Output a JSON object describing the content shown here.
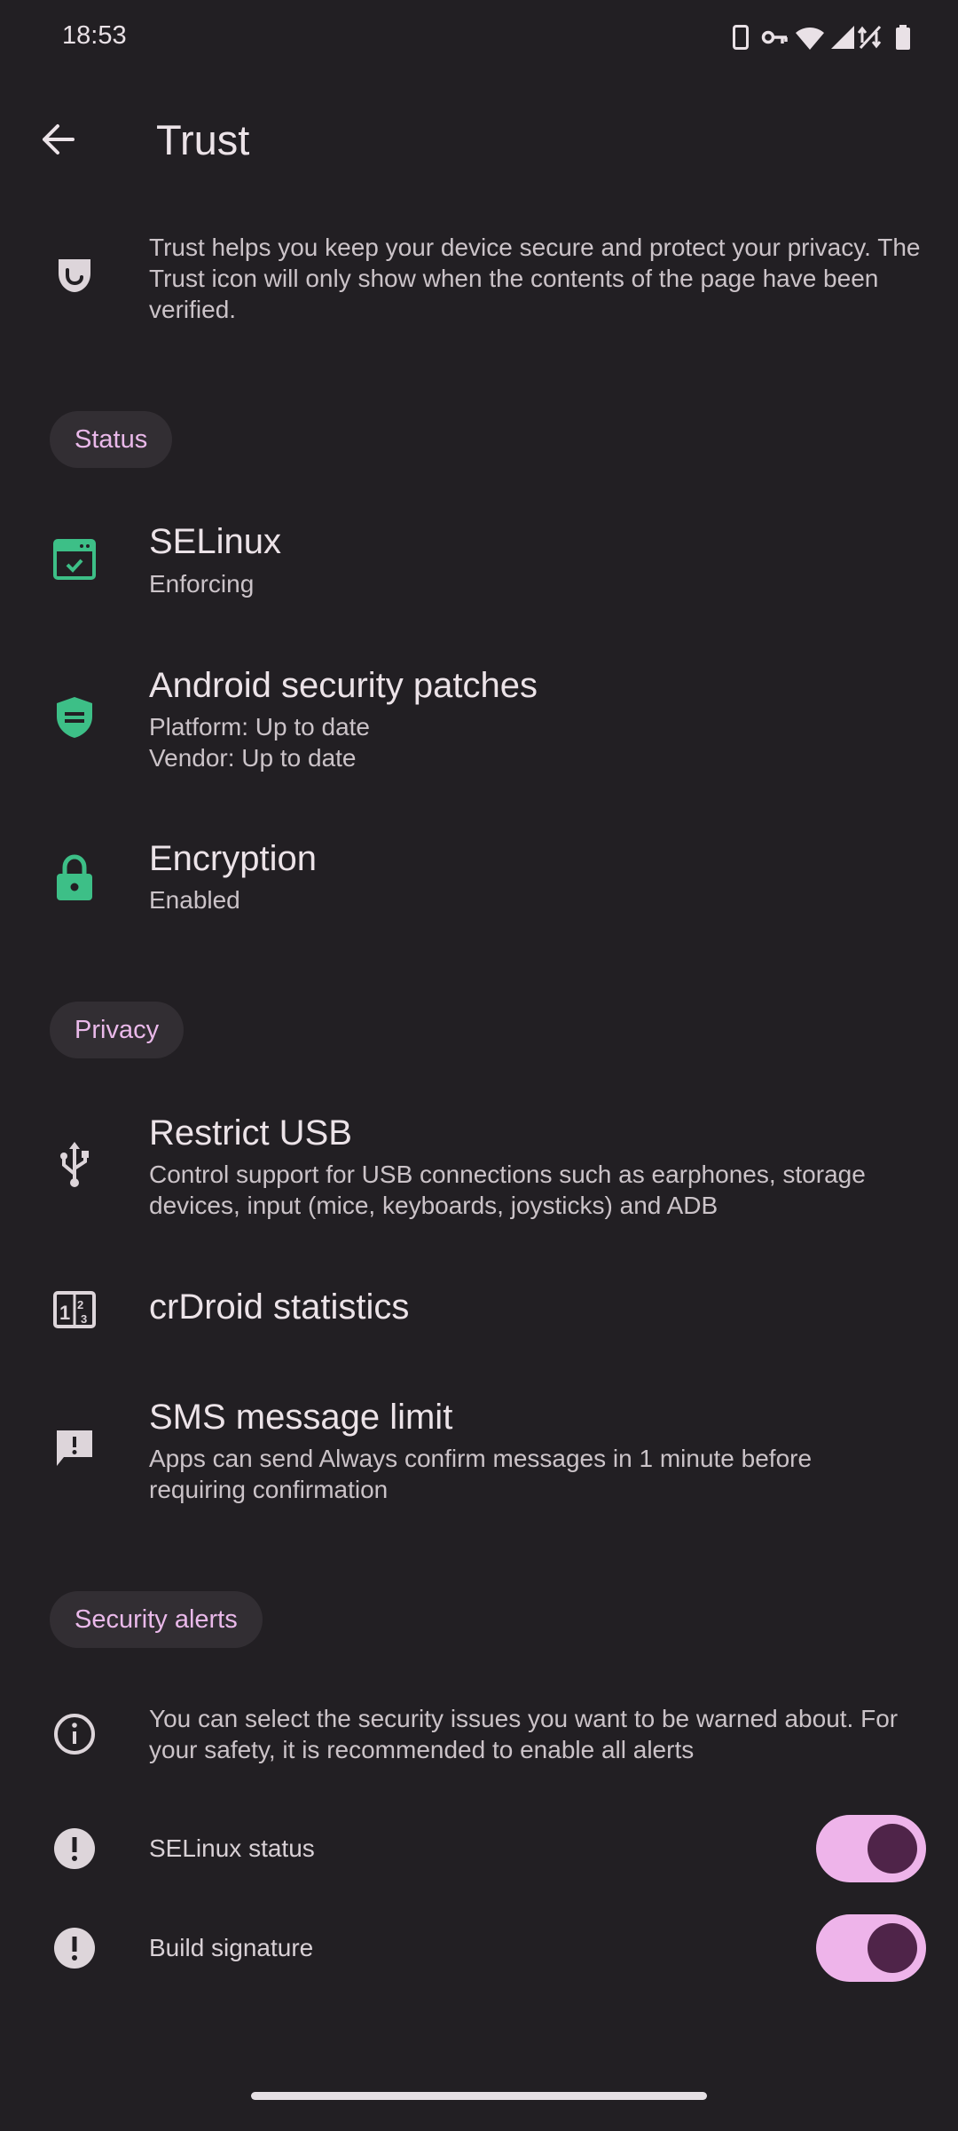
{
  "status_bar": {
    "time": "18:53",
    "icons": [
      "phone-icon",
      "vpn-key-icon",
      "wifi-icon",
      "signal-icon",
      "no-data-icon",
      "battery-icon"
    ]
  },
  "app_bar": {
    "title": "Trust",
    "back_icon": "arrow-back-icon"
  },
  "intro": {
    "text": "Trust helps you keep your device secure and protect your privacy. The Trust icon will only show when the contents of the page have been verified.",
    "icon": "trust-shield-icon"
  },
  "sections": {
    "status": {
      "label": "Status",
      "selinux": {
        "title": "SELinux",
        "summary": "Enforcing",
        "icon": "selinux-window-icon"
      },
      "patches": {
        "title": "Android security patches",
        "platform": "Platform: Up to date",
        "vendor": "Vendor: Up to date",
        "icon": "shield-icon"
      },
      "encryption": {
        "title": "Encryption",
        "summary": "Enabled",
        "icon": "lock-icon"
      }
    },
    "privacy": {
      "label": "Privacy",
      "usb": {
        "title": "Restrict USB",
        "summary": "Control support for USB connections such as earphones, storage devices, input (mice, keyboards, joysticks) and ADB",
        "icon": "usb-icon"
      },
      "stats": {
        "title": "crDroid statistics",
        "icon": "statistics-icon"
      },
      "sms": {
        "title": "SMS message limit",
        "summary": "Apps can send Always confirm messages in 1 minute before requiring confirmation",
        "icon": "sms-alert-icon"
      }
    },
    "security_alerts": {
      "label": "Security alerts",
      "info": "You can select the security issues you want to be warned about. For your safety, it is recommended to enable all alerts",
      "selinux_status": {
        "label": "SELinux status",
        "enabled": true
      },
      "build_signature": {
        "label": "Build signature",
        "enabled": true
      }
    }
  },
  "colors": {
    "background": "#221f23",
    "accent_green": "#3dbf87",
    "chip_text": "#eab9ea",
    "toggle_track": "#eeb4ea",
    "toggle_knob": "#4f2449"
  }
}
